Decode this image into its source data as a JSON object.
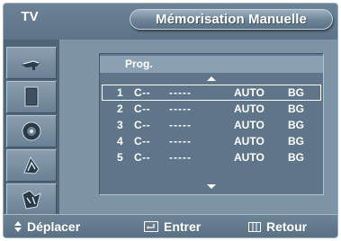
{
  "header": {
    "tv_label": "TV",
    "title": "Mémorisation Manuelle"
  },
  "sidebar": {
    "items": [
      {
        "icon": "antenna-icon"
      },
      {
        "icon": "monitor-icon"
      },
      {
        "icon": "speaker-icon"
      },
      {
        "icon": "settings-icon"
      },
      {
        "icon": "input-icon"
      }
    ]
  },
  "list": {
    "header": "Prog.",
    "rows": [
      {
        "num": "1",
        "channel": "C--",
        "name": "-----",
        "mode": "AUTO",
        "system": "BG",
        "selected": true
      },
      {
        "num": "2",
        "channel": "C--",
        "name": "-----",
        "mode": "AUTO",
        "system": "BG",
        "selected": false
      },
      {
        "num": "3",
        "channel": "C--",
        "name": "-----",
        "mode": "AUTO",
        "system": "BG",
        "selected": false
      },
      {
        "num": "4",
        "channel": "C--",
        "name": "-----",
        "mode": "AUTO",
        "system": "BG",
        "selected": false
      },
      {
        "num": "5",
        "channel": "C--",
        "name": "-----",
        "mode": "AUTO",
        "system": "BG",
        "selected": false
      }
    ]
  },
  "footer": {
    "move_label": "Déplacer",
    "enter_label": "Entrer",
    "return_label": "Retour"
  },
  "colors": {
    "background": "#7e95a8",
    "header": "#5d7387",
    "panel": "#5f768a",
    "text": "#ffffff"
  }
}
